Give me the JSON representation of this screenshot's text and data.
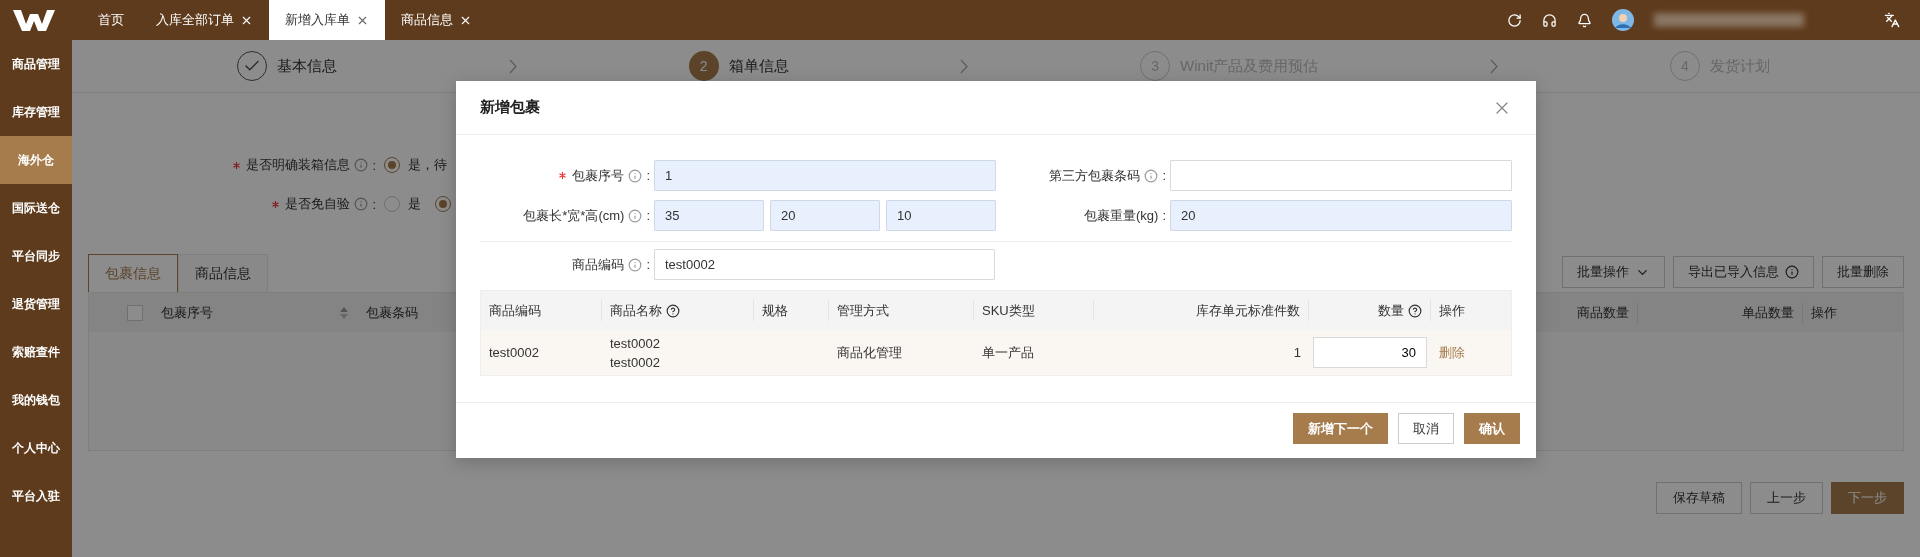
{
  "top_bar": {
    "tabs": [
      {
        "label": "首页",
        "closable": false,
        "selected": false
      },
      {
        "label": "入库全部订单",
        "closable": true,
        "selected": false
      },
      {
        "label": "新增入库单",
        "closable": true,
        "selected": true
      },
      {
        "label": "商品信息",
        "closable": true,
        "selected": false
      }
    ]
  },
  "sidebar": {
    "items": [
      {
        "label": "商品管理",
        "selected": false
      },
      {
        "label": "库存管理",
        "selected": false
      },
      {
        "label": "海外仓",
        "selected": true
      },
      {
        "label": "国际送仓",
        "selected": false
      },
      {
        "label": "平台同步",
        "selected": false
      },
      {
        "label": "退货管理",
        "selected": false
      },
      {
        "label": "索赔查件",
        "selected": false
      },
      {
        "label": "我的钱包",
        "selected": false
      },
      {
        "label": "个人中心",
        "selected": false
      },
      {
        "label": "平台入驻",
        "selected": false
      }
    ]
  },
  "steps": [
    {
      "completed": true,
      "current": false,
      "label": "基本信息"
    },
    {
      "completed": false,
      "current": true,
      "number": "2",
      "label": "箱单信息"
    },
    {
      "completed": false,
      "current": false,
      "number": "3",
      "label": "Winit产品及费用预估"
    },
    {
      "completed": false,
      "current": false,
      "number": "4",
      "label": "发货计划"
    }
  ],
  "form": {
    "fields": [
      {
        "label": "是否明确装箱信息",
        "required": true,
        "info": true,
        "colon": ":",
        "options": [
          {
            "label": "是，待",
            "selected": true
          }
        ]
      },
      {
        "label": "是否免自验",
        "required": true,
        "info": true,
        "colon": ":",
        "options": [
          {
            "label": "是",
            "selected": false
          },
          {
            "selected": true
          }
        ]
      }
    ]
  },
  "section_tabs": [
    {
      "label": "包裹信息",
      "selected": true
    },
    {
      "label": "商品信息",
      "selected": false
    }
  ],
  "toolbar": [
    {
      "label": "批量操作",
      "kind": "dropdown"
    },
    {
      "label": "导出已导入信息",
      "kind": "info"
    },
    {
      "label": "批量删除",
      "kind": "plain"
    }
  ],
  "package_table": {
    "select_all": {
      "checked": false
    },
    "columns_left": [
      {
        "label": "包裹序号",
        "sortable": true
      },
      {
        "label": "包裹条码"
      }
    ],
    "columns_right": [
      {
        "label": "商品数量"
      },
      {
        "label": "单品数量"
      },
      {
        "label": "操作"
      }
    ]
  },
  "page_actions": [
    {
      "label": "保存草稿",
      "kind": "default"
    },
    {
      "label": "上一步",
      "kind": "default"
    },
    {
      "label": "下一步",
      "kind": "primary"
    }
  ],
  "modal": {
    "title": "新增包裹",
    "fields": [
      {
        "label": "包裹序号",
        "required": true,
        "info": true,
        "colon": ":",
        "values": [
          "1"
        ],
        "highlighted": true
      },
      {
        "label": "第三方包裹条码",
        "required": false,
        "info": true,
        "colon": ":",
        "highlighted": false
      },
      {
        "label": "包裹长*宽*高(cm)",
        "required": false,
        "info": true,
        "colon": ":",
        "values": [
          "35",
          "20",
          "10"
        ],
        "highlighted": true
      },
      {
        "label": "包裹重量(kg)",
        "required": false,
        "info": false,
        "colon": ":",
        "values": [
          "20"
        ],
        "highlighted": true
      }
    ],
    "product_code": {
      "label": "商品编码",
      "required": false,
      "info": true,
      "colon": ":",
      "values": [
        "test0002"
      ],
      "highlighted": false
    },
    "table": {
      "columns": [
        {
          "label": "商品编码",
          "help": false,
          "align_right": false
        },
        {
          "label": "商品名称",
          "help": true,
          "align_right": false
        },
        {
          "label": "规格",
          "help": false,
          "align_right": false
        },
        {
          "label": "管理方式",
          "help": false,
          "align_right": false
        },
        {
          "label": "SKU类型",
          "help": false,
          "align_right": false
        },
        {
          "label": "库存单元标准件数",
          "help": false,
          "align_right": true
        },
        {
          "label": "数量",
          "help": true,
          "align_right": true
        },
        {
          "label": "操作",
          "help": false,
          "align_right": false
        }
      ],
      "rows": [
        {
          "product_code": "test0002",
          "product_name": [
            "test0002",
            "test0002"
          ],
          "management": "商品化管理",
          "sku_type": "单一产品",
          "standard_units": "1",
          "quantity": "30",
          "action": "删除"
        }
      ]
    },
    "buttons": [
      {
        "label": "新增下一个",
        "kind": "primary"
      },
      {
        "label": "取消",
        "kind": "default"
      },
      {
        "label": "确认",
        "kind": "primary"
      }
    ]
  }
}
